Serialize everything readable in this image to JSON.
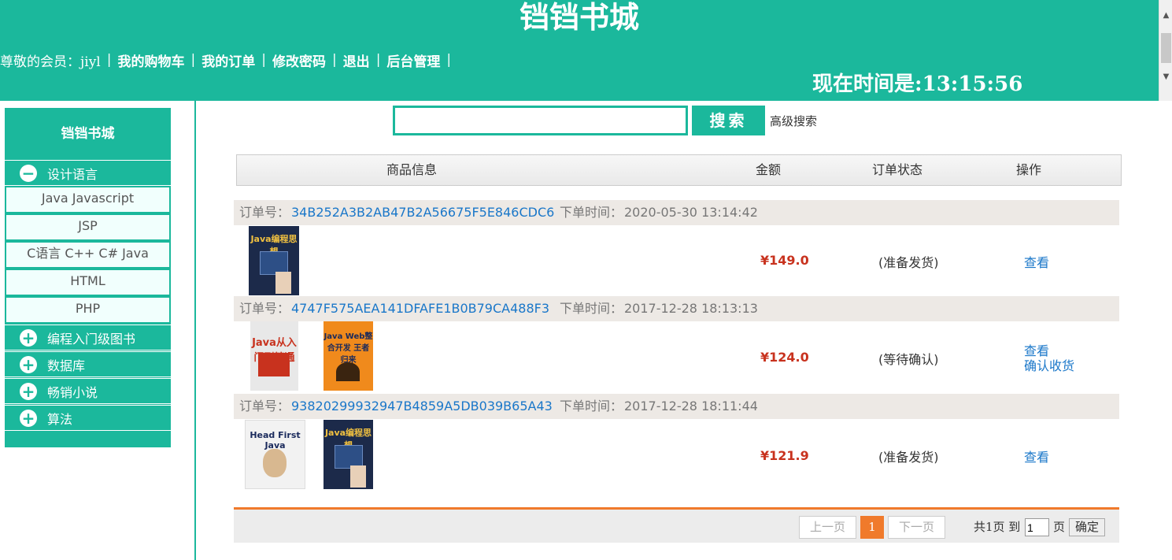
{
  "header": {
    "site_title": "铛铛书城",
    "greeting": "尊敬的会员：jiyl",
    "nav": [
      "我的购物车",
      "我的订单",
      "修改密码",
      "退出",
      "后台管理"
    ],
    "clock": "现在时间是:13:15:56"
  },
  "sidebar": {
    "title": "铛铛书城",
    "categories": [
      {
        "label": "设计语言",
        "icon": "minus-icon",
        "items": [
          "Java Javascript",
          "JSP",
          "C语言 C++ C# Java",
          "HTML",
          "PHP"
        ]
      },
      {
        "label": "编程入门级图书",
        "icon": "plus-icon"
      },
      {
        "label": "数据库",
        "icon": "plus-icon"
      },
      {
        "label": "畅销小说",
        "icon": "plus-icon"
      },
      {
        "label": "算法",
        "icon": "plus-icon"
      }
    ]
  },
  "search": {
    "value": "",
    "button": "搜索",
    "advanced": "高级搜索"
  },
  "table": {
    "columns": [
      "商品信息",
      "金额",
      "订单状态",
      "操作"
    ]
  },
  "orders": [
    {
      "no_label": "订单号：",
      "id": "34B252A3B2AB47B2A56675F5E846CDC6",
      "time_label": "下单时间：",
      "time": "2020-05-30 13:14:42",
      "books": [
        {
          "title": "Java编程思想",
          "cover": "#1c2a4a"
        }
      ],
      "amount": "¥149.0",
      "status": "(准备发货)",
      "actions": [
        "查看"
      ]
    },
    {
      "no_label": "订单号：",
      "id": "4747F575AEA141DFAFE1B0B79CA488F3",
      "time_label": "下单时间：",
      "time": "2017-12-28 18:13:13",
      "books": [
        {
          "title": "Java从入门到精通",
          "cover": "#e8e8e8"
        },
        {
          "title": "Java Web整合开发 王者归来",
          "cover": "#f08a1c"
        }
      ],
      "amount": "¥124.0",
      "status": "(等待确认)",
      "actions": [
        "查看",
        "确认收货"
      ]
    },
    {
      "no_label": "订单号：",
      "id": "93820299932947B4859A5DB039B65A43",
      "time_label": "下单时间：",
      "time": "2017-12-28 18:11:44",
      "books": [
        {
          "title": "Head First Java",
          "cover": "#f2f2f2"
        },
        {
          "title": "Java编程思想",
          "cover": "#1c2a4a"
        }
      ],
      "amount": "¥121.9",
      "status": "(准备发货)",
      "actions": [
        "查看"
      ]
    }
  ],
  "pager": {
    "prev": "上一页",
    "current": "1",
    "next": "下一页",
    "info": "共1页 到",
    "input_value": "1",
    "unit": "页",
    "go": "确定"
  },
  "colors": {
    "primary": "#1bb89c",
    "accent": "#f07a2b",
    "price": "#c8321e",
    "link": "#1a77c9"
  }
}
